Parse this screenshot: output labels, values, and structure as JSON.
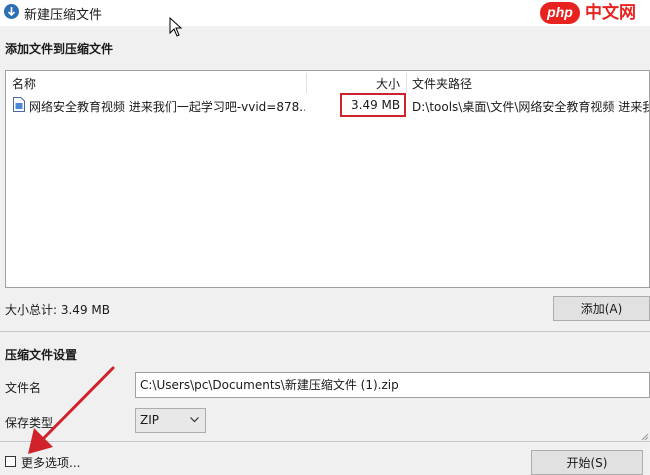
{
  "window": {
    "title": "新建压缩文件",
    "watermark_brand": "php",
    "watermark_cn": "中文网"
  },
  "add_section": {
    "title": "添加文件到压缩文件"
  },
  "file_list": {
    "columns": [
      "名称",
      "大小",
      "文件夹路径"
    ],
    "rows": [
      {
        "name": "网络安全教育视频 进来我们一起学习吧-vvid=878...",
        "size": "3.49 MB",
        "path": "D:\\tools\\桌面\\文件\\网络安全教育视频 进来我"
      }
    ]
  },
  "summary": {
    "total_size": "大小总计: 3.49 MB",
    "add_button": "添加(A)"
  },
  "settings": {
    "title": "压缩文件设置",
    "filename_label": "文件名",
    "filename_value": "C:\\Users\\pc\\Documents\\新建压缩文件 (1).zip",
    "type_label": "保存类型",
    "type_value": "ZIP"
  },
  "footer": {
    "more_options": "更多选项...",
    "start_button": "开始(S)"
  },
  "colors": {
    "highlight_box": "#d0222a",
    "annotation_arrow": "#d0222a",
    "app_icon": "#2d6fb4"
  }
}
